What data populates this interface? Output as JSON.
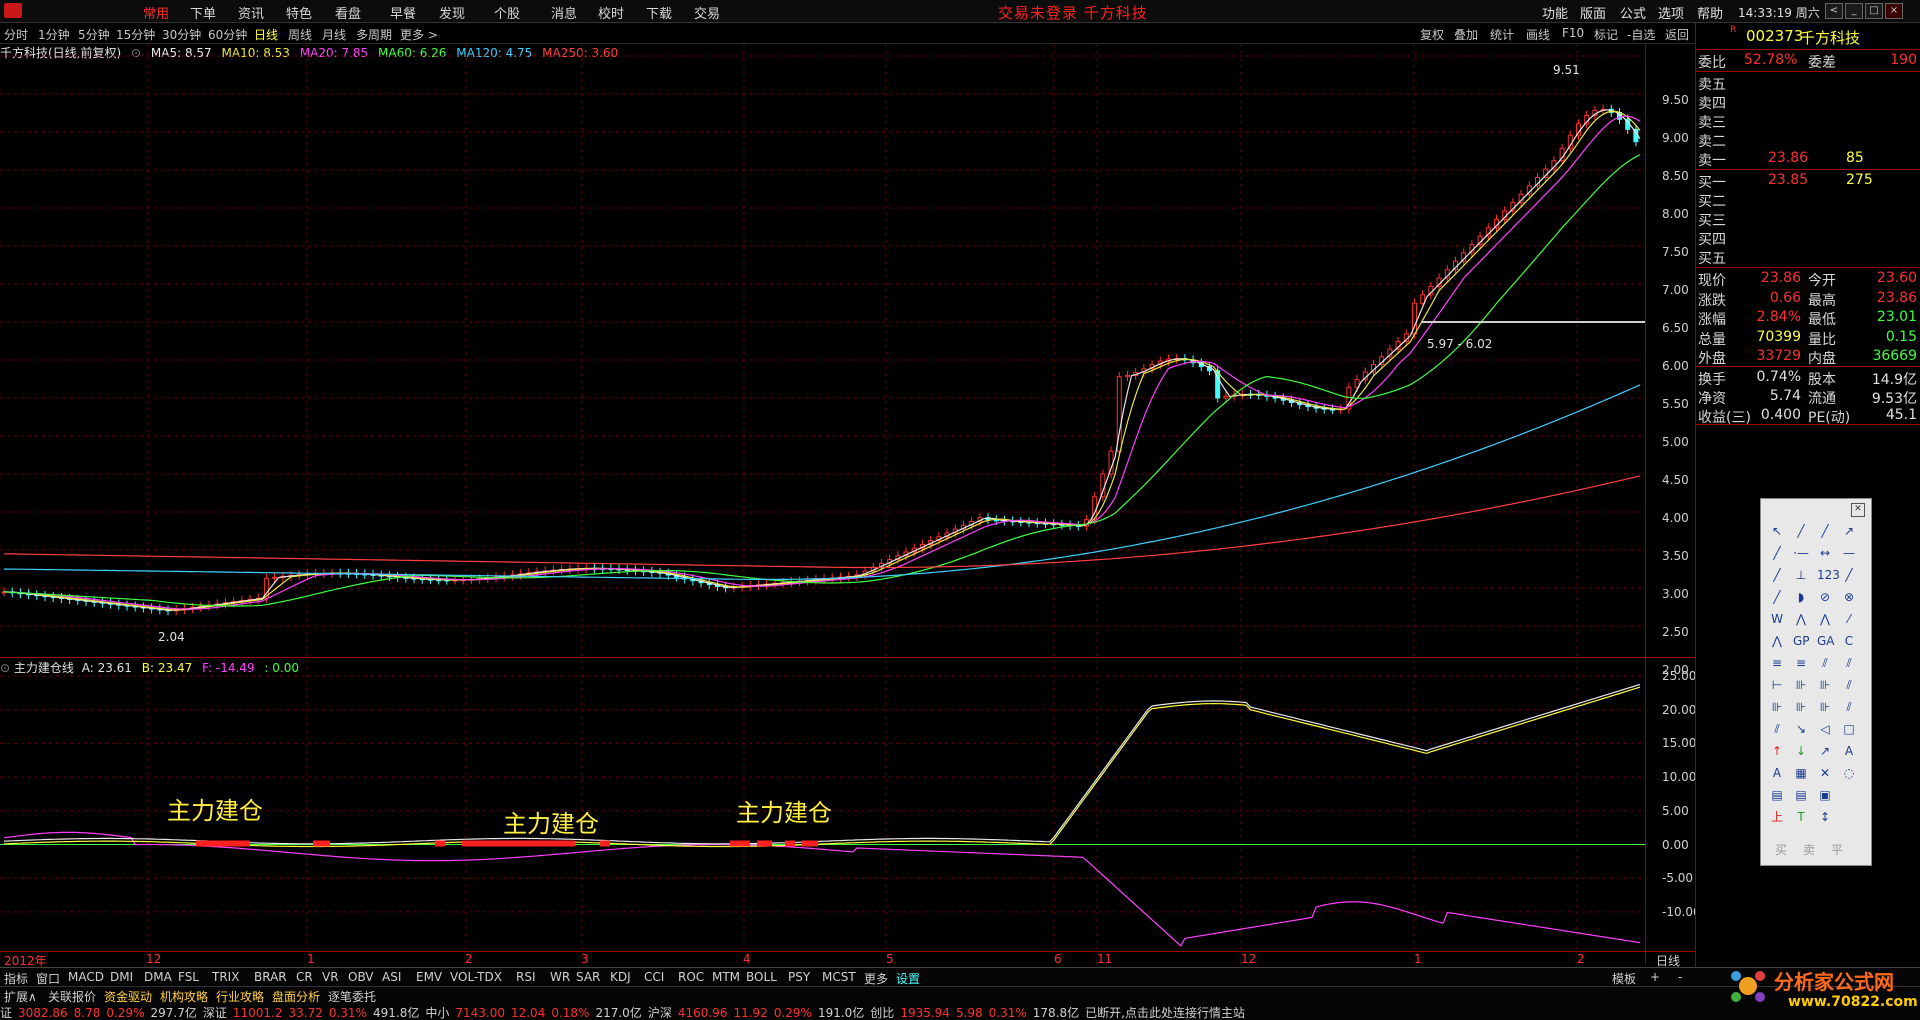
{
  "menubar": {
    "items": [
      "常用",
      "下单",
      "资讯",
      "特色",
      "看盘",
      "早餐",
      "发现",
      "个股",
      "消息",
      "校时",
      "下载",
      "交易"
    ],
    "center_status": "交易未登录  千方科技",
    "right_items": [
      "功能",
      "版面",
      "公式",
      "选项",
      "帮助"
    ],
    "time": "14:33:19 周六",
    "window_buttons": [
      "<",
      "_",
      "□",
      "×"
    ]
  },
  "periodbar": {
    "periods": [
      "分时",
      "1分钟",
      "5分钟",
      "15分钟",
      "30分钟",
      "60分钟",
      "日线",
      "周线",
      "月线",
      "多周期",
      "更多 >"
    ],
    "active": "日线",
    "tools": [
      "复权",
      "叠加",
      "统计",
      "画线",
      "F10",
      "标记",
      "-自选",
      "返回"
    ]
  },
  "main_chart": {
    "title": "千方科技(日线,前复权)",
    "ma": [
      {
        "label": "MA5: 8.57",
        "color": "#e8e8e8"
      },
      {
        "label": "MA10: 8.53",
        "color": "#e8e840"
      },
      {
        "label": "MA20: 7.85",
        "color": "#ff40ff"
      },
      {
        "label": "MA60: 6.26",
        "color": "#40ff40"
      },
      {
        "label": "MA120: 4.75",
        "color": "#40d0ff"
      },
      {
        "label": "MA250: 3.60",
        "color": "#ff4040"
      }
    ],
    "yticks": [
      "9.50",
      "9.00",
      "8.50",
      "8.00",
      "7.50",
      "7.00",
      "6.50",
      "6.00",
      "5.50",
      "5.00",
      "4.50",
      "4.00",
      "3.50",
      "3.00",
      "2.50",
      "2.00"
    ],
    "high_label": "9.51",
    "low_label": "2.04",
    "range_label": "5.97 - 6.02"
  },
  "indicator": {
    "name": "主力建仓线",
    "a": "A: 23.61",
    "b": "B: 23.47",
    "f": "F: -14.49",
    "z": ": 0.00",
    "yticks": [
      "25.00",
      "20.00",
      "15.00",
      "10.00",
      "5.00",
      "0.00",
      "-5.00",
      "-10.00"
    ],
    "annotations": [
      "主力建仓",
      "主力建仓",
      "主力建仓"
    ]
  },
  "x_axis": {
    "labels": [
      "2012年",
      "12",
      "1",
      "2",
      "3",
      "4",
      "5",
      "6",
      "11",
      "12",
      "1",
      "2"
    ],
    "right": "日线"
  },
  "indicator_tabs": [
    "指标",
    "窗口",
    "MACD",
    "DMI",
    "DMA",
    "FSL",
    "TRIX",
    "BRAR",
    "CR",
    "VR",
    "OBV",
    "ASI",
    "EMV",
    "VOL-TDX",
    "RSI",
    "WR",
    "SAR",
    "KDJ",
    "CCI",
    "ROC",
    "MTM",
    "BOLL",
    "PSY",
    "MCST",
    "更多",
    "设置"
  ],
  "tabbar_right": [
    "模板",
    "+",
    "-"
  ],
  "sub_tabs": [
    "扩展∧",
    "关联报价",
    "资金驱动",
    "机构攻略",
    "行业攻略",
    "盘面分析",
    "逐笔委托"
  ],
  "statusbar": [
    {
      "t": "证",
      "c": "#d0d0d0"
    },
    {
      "t": "3082.86",
      "c": "#ff3030"
    },
    {
      "t": "8.78",
      "c": "#ff3030"
    },
    {
      "t": "0.29%",
      "c": "#ff3030"
    },
    {
      "t": "297.7亿",
      "c": "#d0d0d0"
    },
    {
      "t": "深证",
      "c": "#d0d0d0"
    },
    {
      "t": "11001.2",
      "c": "#ff3030"
    },
    {
      "t": "33.72",
      "c": "#ff3030"
    },
    {
      "t": "0.31%",
      "c": "#ff3030"
    },
    {
      "t": "491.8亿",
      "c": "#d0d0d0"
    },
    {
      "t": "中小",
      "c": "#d0d0d0"
    },
    {
      "t": "7143.00",
      "c": "#ff3030"
    },
    {
      "t": "12.04",
      "c": "#ff3030"
    },
    {
      "t": "0.18%",
      "c": "#ff3030"
    },
    {
      "t": "217.0亿",
      "c": "#d0d0d0"
    },
    {
      "t": "沪深",
      "c": "#d0d0d0"
    },
    {
      "t": "4160.96",
      "c": "#ff3030"
    },
    {
      "t": "11.92",
      "c": "#ff3030"
    },
    {
      "t": "0.29%",
      "c": "#ff3030"
    },
    {
      "t": "191.0亿",
      "c": "#d0d0d0"
    },
    {
      "t": "创比",
      "c": "#d0d0d0"
    },
    {
      "t": "1935.94",
      "c": "#ff3030"
    },
    {
      "t": "5.98",
      "c": "#ff3030"
    },
    {
      "t": "0.31%",
      "c": "#ff3030"
    },
    {
      "t": "178.8亿",
      "c": "#d0d0d0"
    },
    {
      "t": "已断开,点击此处连接行情主站",
      "c": "#d0d0d0"
    }
  ],
  "rpanel": {
    "code": "002373",
    "name": "千方科技",
    "wb": {
      "l1": "委比",
      "v1": "52.78%",
      "l2": "委差",
      "v2": "190"
    },
    "sells": [
      {
        "l": "卖五",
        "p": "",
        "v": ""
      },
      {
        "l": "卖四",
        "p": "",
        "v": ""
      },
      {
        "l": "卖三",
        "p": "",
        "v": ""
      },
      {
        "l": "卖二",
        "p": "",
        "v": ""
      },
      {
        "l": "卖一",
        "p": "23.86",
        "v": "85"
      }
    ],
    "buys": [
      {
        "l": "买一",
        "p": "23.85",
        "v": "275"
      },
      {
        "l": "买二",
        "p": "",
        "v": ""
      },
      {
        "l": "买三",
        "p": "",
        "v": ""
      },
      {
        "l": "买四",
        "p": "",
        "v": ""
      },
      {
        "l": "买五",
        "p": "",
        "v": ""
      }
    ],
    "quote": [
      {
        "l1": "现价",
        "v1": "23.86",
        "c1": "#ff3030",
        "l2": "今开",
        "v2": "23.60",
        "c2": "#ff3030"
      },
      {
        "l1": "涨跌",
        "v1": "0.66",
        "c1": "#ff3030",
        "l2": "最高",
        "v2": "23.86",
        "c2": "#ff3030"
      },
      {
        "l1": "涨幅",
        "v1": "2.84%",
        "c1": "#ff3030",
        "l2": "最低",
        "v2": "23.01",
        "c2": "#40ff40"
      },
      {
        "l1": "总量",
        "v1": "70399",
        "c1": "#ffff40",
        "l2": "量比",
        "v2": "0.15",
        "c2": "#40ff40"
      },
      {
        "l1": "外盘",
        "v1": "33729",
        "c1": "#ff3030",
        "l2": "内盘",
        "v2": "36669",
        "c2": "#40ff40"
      }
    ],
    "stats": [
      {
        "l1": "换手",
        "v1": "0.74%",
        "l2": "股本",
        "v2": "14.9亿"
      },
      {
        "l1": "净资",
        "v1": "5.74",
        "l2": "流通",
        "v2": "9.53亿"
      },
      {
        "l1": "收益(三)",
        "v1": "0.400",
        "l2": "PE(动)",
        "v2": "45.1"
      }
    ]
  },
  "toolbox": {
    "bottom_labels": [
      "买",
      "卖",
      "平"
    ]
  },
  "watermark": {
    "brand": "分析家公式网",
    "url": "www.70822.com"
  },
  "colors": {
    "up": "#ff3030",
    "down": "#40ffff",
    "grid": "#9a0000",
    "annotation": "#ffef40"
  }
}
